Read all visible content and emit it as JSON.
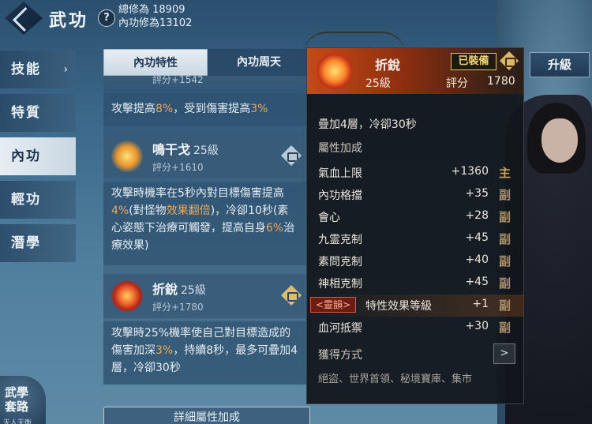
{
  "header": {
    "title": "武功",
    "total_cultivation": "總修為 18909",
    "inner_cultivation": "內功修為13102"
  },
  "nav": {
    "items": [
      {
        "label": "技能"
      },
      {
        "label": "特質"
      },
      {
        "label": "內功"
      },
      {
        "label": "輕功"
      },
      {
        "label": "潛學"
      }
    ]
  },
  "tabs": {
    "tab1": "內功特性",
    "tab2": "內功周天"
  },
  "cards": {
    "top_partial": {
      "score": "評分+1542",
      "desc_prefix": "攻擊提高",
      "desc_val1": "8%",
      "desc_mid": "，受到傷害提高",
      "desc_val2": "3%"
    },
    "mingganguo": {
      "name": "鳴干戈",
      "level": "25級",
      "score": "評分+1610",
      "desc_a": "攻擊時機率在5秒內對目標傷害提高",
      "desc_v1": "4%",
      "desc_b": "(對怪物",
      "desc_v2": "效果翻倍",
      "desc_c": ")，冷卻10秒(素心姿態下治療可觸發，提高自身",
      "desc_v3": "6%",
      "desc_d": "治療效果)"
    },
    "zherui": {
      "name": "折銳",
      "level": "25級",
      "score": "評分+1780",
      "desc_a": "攻擊時25%機率使自己對目標造成的傷害加深",
      "desc_v1": "3%",
      "desc_b": "，持續8秒，最多可疊加4層，冷卻30秒"
    }
  },
  "detail_button": "詳細屬性加成",
  "bottom": {
    "label_line1": "武學",
    "label_line2": "套路",
    "sub": "天人天衡"
  },
  "upgrade_button": "升級",
  "popup": {
    "name": "折銳",
    "equipped": "已裝備",
    "level": "25級",
    "score_label": "評分",
    "score": "1780",
    "stack_text": "疊加4層，冷卻30秒",
    "section_attr": "屬性加成",
    "attributes": [
      {
        "name": "氣血上限",
        "value": "+1360",
        "tag": "主"
      },
      {
        "name": "內功格擋",
        "value": "+35",
        "tag": "副"
      },
      {
        "name": "會心",
        "value": "+28",
        "tag": "副"
      },
      {
        "name": "九霊克制",
        "value": "+45",
        "tag": "副"
      },
      {
        "name": "素問克制",
        "value": "+40",
        "tag": "副"
      },
      {
        "name": "神相克制",
        "value": "+45",
        "tag": "副"
      },
      {
        "name": "特性效果等級",
        "value": "+1",
        "tag": "副",
        "badge": "<靈韻>"
      },
      {
        "name": "血河抵禦",
        "value": "+30",
        "tag": "副"
      }
    ],
    "obtain_label": "獲得方式",
    "obtain_text": "絕盜、世界首領、秘境寶庫、集市"
  },
  "colors": {
    "accent_orange": "#e8a85c",
    "popup_header": "#c64a16",
    "equipped_gold": "#f2d77a"
  }
}
